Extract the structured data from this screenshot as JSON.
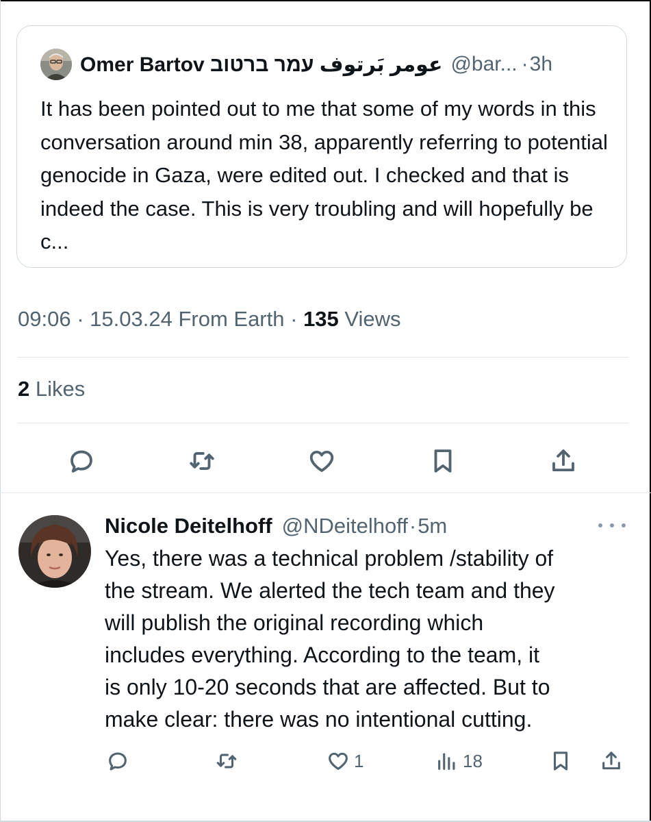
{
  "quoted_tweet": {
    "display_name": "Omer Bartov عومر بَرتوف עמר ברטוב",
    "handle": "@bar...",
    "separator": "·",
    "time": "3h",
    "text": "It has been pointed out to me that some of my words in this conversation around min 38, apparently referring to potential genocide in Gaza, were edited out. I checked and that is indeed the case. This is very troubling and will hopefully be c..."
  },
  "tweet_meta": {
    "time": "09:06",
    "dot": "·",
    "date": "15.03.24",
    "source": "From Earth",
    "views_count": "135",
    "views_label": "Views",
    "likes_count": "2",
    "likes_label": "Likes"
  },
  "actions": [
    "reply-icon",
    "retweet-icon",
    "like-icon",
    "bookmark-icon",
    "share-icon"
  ],
  "reply": {
    "display_name": "Nicole Deitelhoff",
    "handle": "@NDeitelhoff",
    "separator": "·",
    "time": "5m",
    "text": "Yes, there was a technical problem /stability of\nthe stream. We alerted the tech team  and they\nwill publish the original recording which\nincludes everything. According to the team,  it\nis only 10-20 seconds that are affected. But to\nmake clear: there was no intentional cutting.",
    "likes": "1",
    "views": "18"
  },
  "colors": {
    "text": "#0f1419",
    "secondary": "#536471",
    "border": "#cfd9de"
  }
}
